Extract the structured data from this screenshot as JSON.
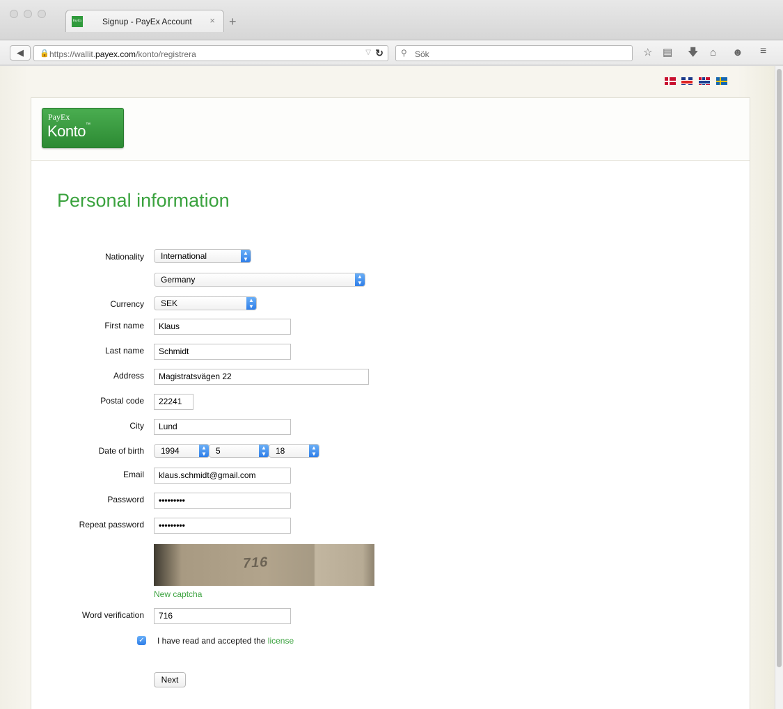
{
  "browser": {
    "tab_title": "Signup - PayEx Account",
    "tab_favicon_text": "PayEx",
    "tab_close": "×",
    "new_tab": "+",
    "url_prefix": "https://wallit.",
    "url_host": "payex.com",
    "url_path": "/konto/registrera",
    "search_placeholder": "Sök",
    "icons": [
      "lock-icon",
      "reload-icon",
      "search-icon",
      "bookmark-star-icon",
      "reading-list-icon",
      "download-icon",
      "home-icon",
      "chat-icon",
      "menu-icon"
    ]
  },
  "languages": [
    "da",
    "en",
    "no",
    "sv"
  ],
  "logo": {
    "small": "PayEx",
    "big": "Konto",
    "tm": "™"
  },
  "form": {
    "title": "Personal information",
    "nationality_label": "Nationality",
    "nationality_value": "International",
    "country_value": "Germany",
    "currency_label": "Currency",
    "currency_value": "SEK",
    "first_name_label": "First name",
    "first_name_value": "Klaus",
    "last_name_label": "Last name",
    "last_name_value": "Schmidt",
    "address_label": "Address",
    "address_value": "Magistratsvägen 22",
    "postal_code_label": "Postal code",
    "postal_code_value": "22241",
    "city_label": "City",
    "city_value": "Lund",
    "dob_label": "Date of birth",
    "dob_year": "1994",
    "dob_month": "5",
    "dob_day": "18",
    "email_label": "Email",
    "email_value": "klaus.schmidt@gmail.com",
    "password_label": "Password",
    "password_value": "•••••••••",
    "repeat_password_label": "Repeat password",
    "repeat_password_value": "•••••••••",
    "captcha_text": "716",
    "new_captcha": "New captcha",
    "word_verification_label": "Word verification",
    "word_verification_value": "716",
    "license_checked": true,
    "license_text": "I have read and accepted the ",
    "license_link": "license",
    "next_button": "Next"
  },
  "colors": {
    "accent_green": "#3aa23e",
    "select_blue": "#2f7ee8"
  }
}
